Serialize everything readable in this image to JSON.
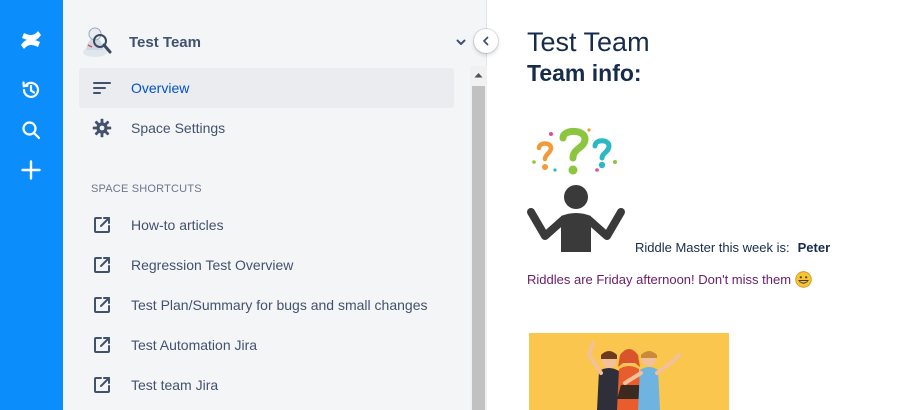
{
  "space": {
    "title": "Test Team"
  },
  "sidebar": {
    "nav": [
      {
        "label": "Overview",
        "icon": "overview-icon",
        "selected": true
      },
      {
        "label": "Space Settings",
        "icon": "gear-icon",
        "selected": false
      }
    ],
    "shortcuts_heading": "SPACE SHORTCUTS",
    "shortcuts": [
      {
        "label": "How-to articles",
        "icon": "external-link-icon"
      },
      {
        "label": "Regression Test Overview",
        "icon": "external-link-icon"
      },
      {
        "label": "Test Plan/Summary for bugs and small changes",
        "icon": "external-link-icon"
      },
      {
        "label": "Test Automation Jira",
        "icon": "external-link-icon"
      },
      {
        "label": "Test team Jira",
        "icon": "external-link-icon"
      }
    ]
  },
  "rail": {
    "items": [
      "confluence-logo-icon",
      "recent-icon",
      "search-icon",
      "create-icon"
    ]
  },
  "page": {
    "title": "Test Team",
    "subtitle": "Team info:",
    "riddle_label": "Riddle Master this week is:",
    "riddle_master": "Peter",
    "riddle_note": "Riddles are Friday afternoon! Don't miss them"
  },
  "colors": {
    "rail": "#0c8dfc",
    "sidebar": "#f4f5f7",
    "selected_text": "#0052cc",
    "note_text": "#6a1b6a",
    "banner": "#fbc64e"
  }
}
